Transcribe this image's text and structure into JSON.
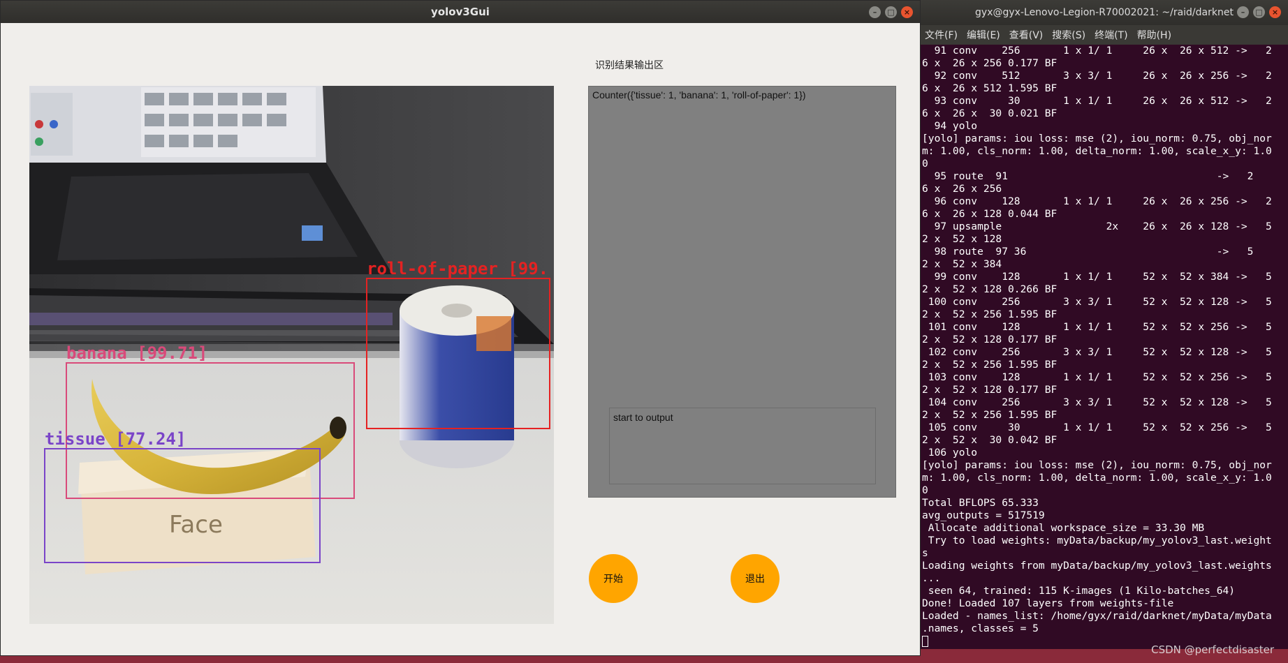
{
  "gui": {
    "title": "yolov3Gui",
    "result_label": "识别结果输出区",
    "result_text": "Counter({'tissue': 1, 'banana': 1, 'roll-of-paper': 1})",
    "status_text": "start to output",
    "start_button": "开始",
    "quit_button": "退出"
  },
  "detections": [
    {
      "label": "roll-of-paper [99.",
      "color": "#e52222"
    },
    {
      "label": "banana [99.71]",
      "color": "#d94a7a"
    },
    {
      "label": "tissue [77.24]",
      "color": "#7a44c8"
    }
  ],
  "terminal": {
    "title": "gyx@gyx-Lenovo-Legion-R70002021: ~/raid/darknet",
    "menu": [
      "文件(F)",
      "编辑(E)",
      "查看(V)",
      "搜索(S)",
      "终端(T)",
      "帮助(H)"
    ],
    "lines": [
      "  91 conv    256       1 x 1/ 1     26 x  26 x 512 ->   2",
      "6 x  26 x 256 0.177 BF",
      "  92 conv    512       3 x 3/ 1     26 x  26 x 256 ->   2",
      "6 x  26 x 512 1.595 BF",
      "  93 conv     30       1 x 1/ 1     26 x  26 x 512 ->   2",
      "6 x  26 x  30 0.021 BF",
      "  94 yolo",
      "[yolo] params: iou loss: mse (2), iou_norm: 0.75, obj_nor",
      "m: 1.00, cls_norm: 1.00, delta_norm: 1.00, scale_x_y: 1.0",
      "0",
      "  95 route  91                                  ->   2",
      "6 x  26 x 256",
      "  96 conv    128       1 x 1/ 1     26 x  26 x 256 ->   2",
      "6 x  26 x 128 0.044 BF",
      "  97 upsample                 2x    26 x  26 x 128 ->   5",
      "2 x  52 x 128",
      "  98 route  97 36                               ->   5",
      "2 x  52 x 384",
      "  99 conv    128       1 x 1/ 1     52 x  52 x 384 ->   5",
      "2 x  52 x 128 0.266 BF",
      " 100 conv    256       3 x 3/ 1     52 x  52 x 128 ->   5",
      "2 x  52 x 256 1.595 BF",
      " 101 conv    128       1 x 1/ 1     52 x  52 x 256 ->   5",
      "2 x  52 x 128 0.177 BF",
      " 102 conv    256       3 x 3/ 1     52 x  52 x 128 ->   5",
      "2 x  52 x 256 1.595 BF",
      " 103 conv    128       1 x 1/ 1     52 x  52 x 256 ->   5",
      "2 x  52 x 128 0.177 BF",
      " 104 conv    256       3 x 3/ 1     52 x  52 x 128 ->   5",
      "2 x  52 x 256 1.595 BF",
      " 105 conv     30       1 x 1/ 1     52 x  52 x 256 ->   5",
      "2 x  52 x  30 0.042 BF",
      " 106 yolo",
      "[yolo] params: iou loss: mse (2), iou_norm: 0.75, obj_nor",
      "m: 1.00, cls_norm: 1.00, delta_norm: 1.00, scale_x_y: 1.0",
      "0",
      "Total BFLOPS 65.333",
      "avg_outputs = 517519",
      " Allocate additional workspace_size = 33.30 MB",
      " Try to load weights: myData/backup/my_yolov3_last.weight",
      "s",
      "Loading weights from myData/backup/my_yolov3_last.weights",
      "...",
      " seen 64, trained: 115 K-images (1 Kilo-batches_64)",
      "Done! Loaded 107 layers from weights-file",
      "Loaded - names_list: /home/gyx/raid/darknet/myData/myData",
      ".names, classes = 5"
    ]
  },
  "watermark": "CSDN @perfectdisaster"
}
